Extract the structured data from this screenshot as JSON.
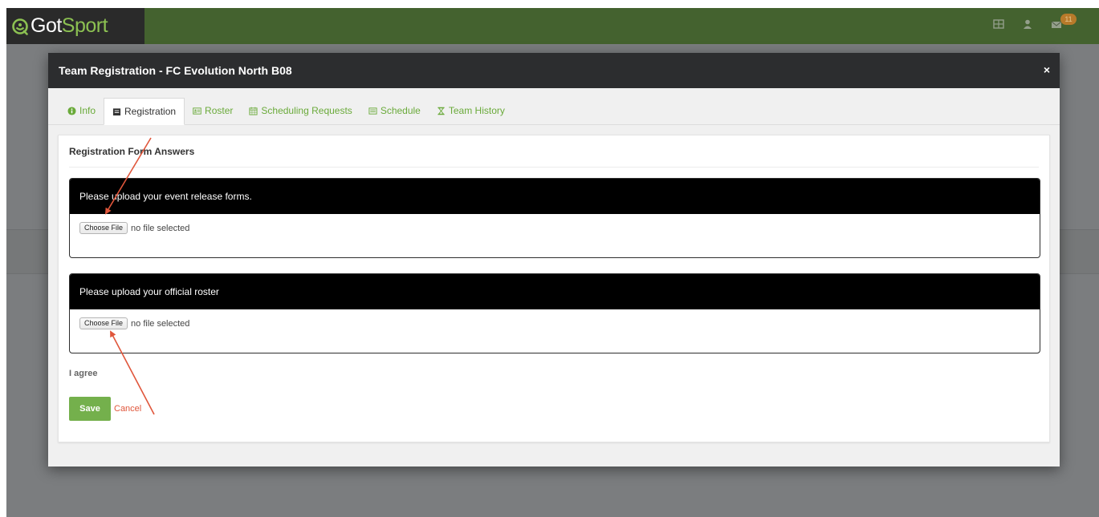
{
  "app": {
    "logo_got": "Got",
    "logo_sport": "Sport",
    "mail_badge": "11"
  },
  "modal": {
    "title": "Team Registration - FC Evolution North B08",
    "close_label": "×"
  },
  "tabs": [
    {
      "label": "Info",
      "icon": "info-circle-icon",
      "active": false
    },
    {
      "label": "Registration",
      "icon": "clipboard-icon",
      "active": true
    },
    {
      "label": "Roster",
      "icon": "id-card-icon",
      "active": false
    },
    {
      "label": "Scheduling Requests",
      "icon": "calendar-icon",
      "active": false
    },
    {
      "label": "Schedule",
      "icon": "list-icon",
      "active": false
    },
    {
      "label": "Team History",
      "icon": "hourglass-icon",
      "active": false
    }
  ],
  "form": {
    "title": "Registration Form Answers",
    "questions": [
      {
        "prompt": "Please upload your event release forms.",
        "button": "Choose File",
        "status": "no file selected"
      },
      {
        "prompt": "Please upload your official roster",
        "button": "Choose File",
        "status": "no file selected"
      }
    ],
    "agree_label": "I agree",
    "save_label": "Save",
    "cancel_label": "Cancel"
  },
  "colors": {
    "topbar": "#44622f",
    "accent_green": "#74b04c",
    "tab_green": "#6aaa3a",
    "cancel_red": "#e0563b",
    "annotation_arrow": "#e0563b"
  }
}
